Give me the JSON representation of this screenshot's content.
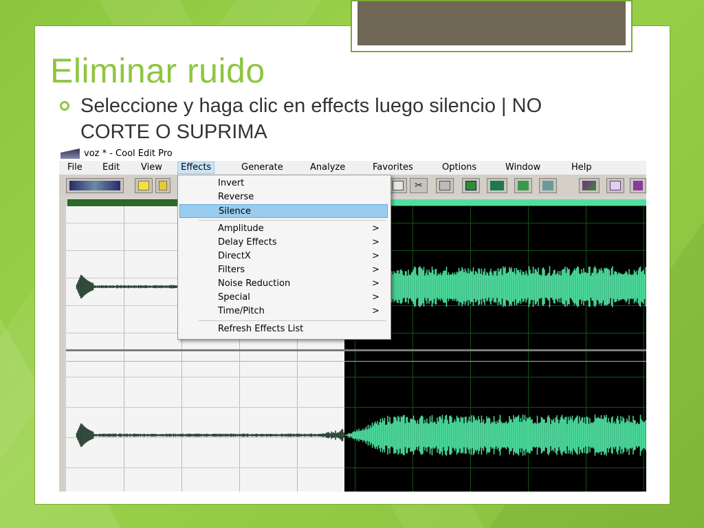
{
  "slide": {
    "title": "Eliminar ruido",
    "bullet": "Seleccione y haga clic en effects luego silencio | NO CORTE O SUPRIMA",
    "colors": {
      "background": "#8cc63f",
      "title": "#8dc63f",
      "text": "#333333"
    }
  },
  "app": {
    "window_title": "voz * - Cool Edit Pro",
    "menu": [
      "File",
      "Edit",
      "View",
      "Effects",
      "Generate",
      "Analyze",
      "Favorites",
      "Options",
      "Window",
      "Help"
    ],
    "active_menu": "Effects",
    "effects_menu": {
      "group1": [
        {
          "label": "Invert",
          "submenu": ""
        },
        {
          "label": "Reverse",
          "submenu": ""
        },
        {
          "label": "Silence",
          "submenu": "",
          "highlighted": true
        }
      ],
      "group2": [
        {
          "label": "Amplitude",
          "submenu": ">"
        },
        {
          "label": "Delay Effects",
          "submenu": ">"
        },
        {
          "label": "DirectX",
          "submenu": ">"
        },
        {
          "label": "Filters",
          "submenu": ">"
        },
        {
          "label": "Noise Reduction",
          "submenu": ">"
        },
        {
          "label": "Special",
          "submenu": ">"
        },
        {
          "label": "Time/Pitch",
          "submenu": ">"
        }
      ],
      "group3": [
        {
          "label": "Refresh Effects List",
          "submenu": ""
        }
      ]
    },
    "toolbar_icons": [
      "waveform-toggle-icon",
      "new-file-icon",
      "open-folder-icon",
      "copy-icon",
      "cut-icon",
      "paste-icon",
      "mix-paste-icon",
      "trim-icon",
      "zoom-icon",
      "loop-icon",
      "spectral-view-icon",
      "script-icon",
      "multitrack-icon"
    ],
    "waveform": {
      "selected_color": "#4fe0a0",
      "unselected_color": "#1e3a2a",
      "selection_background": "#000000"
    }
  }
}
